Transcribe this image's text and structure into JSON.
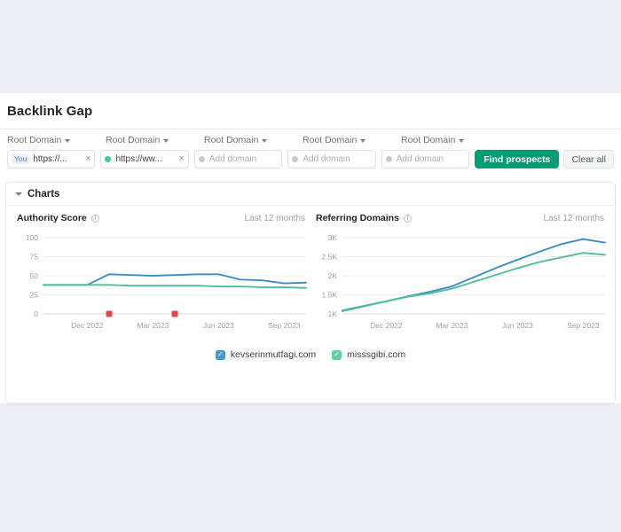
{
  "header": {
    "title": "Backlink Gap"
  },
  "toolbar": {
    "domain_label": "Root Domain",
    "columns": [
      {
        "label": "Root Domain",
        "badge": "You",
        "value": "https://...",
        "dot": null,
        "placeholder": null
      },
      {
        "label": "Root Domain",
        "badge": null,
        "value": "https://ww...",
        "dot": "green",
        "placeholder": null
      },
      {
        "label": "Root Domain",
        "badge": null,
        "value": null,
        "dot": "grey",
        "placeholder": "Add domain"
      },
      {
        "label": "Root Domain",
        "badge": null,
        "value": null,
        "dot": "grey",
        "placeholder": "Add domain"
      },
      {
        "label": "Root Domain",
        "badge": null,
        "value": null,
        "dot": "grey",
        "placeholder": "Add domain"
      }
    ],
    "find_prospects_label": "Find prospects",
    "clear_all_label": "Clear all",
    "close_icon": "×"
  },
  "charts_card": {
    "title": "Charts",
    "legend": [
      {
        "label": "kevserinmutfagi.com",
        "color": "#3f9ad6",
        "checked": true
      },
      {
        "label": "misssgibi.com",
        "color": "#5fd1a0",
        "checked": true
      }
    ],
    "check_glyph": "✓"
  },
  "colors": {
    "series_blue": "#3f8fc4",
    "series_green": "#4fbf96",
    "accent_green": "#009e74",
    "marker_red": "#e8434a",
    "page_bg": "#eceef4",
    "grid": "#eceef0"
  },
  "chart_data": [
    {
      "type": "line",
      "title": "Authority Score",
      "period": "Last 12 months",
      "xlabel": "",
      "ylabel": "",
      "ylim": [
        0,
        100
      ],
      "yticks": [
        "0",
        "25",
        "50",
        "75",
        "100"
      ],
      "ytick_values": [
        0,
        25,
        50,
        75,
        100
      ],
      "xticks": [
        "Dec 2022",
        "Mar 2023",
        "Jun 2023",
        "Sep 2023"
      ],
      "grid": true,
      "legend_position": "bottom",
      "x": [
        "Oct 2022",
        "Nov 2022",
        "Dec 2022",
        "Jan 2023",
        "Feb 2023",
        "Mar 2023",
        "Apr 2023",
        "May 2023",
        "Jun 2023",
        "Jul 2023",
        "Aug 2023",
        "Sep 2023",
        "Oct 2023"
      ],
      "series": [
        {
          "name": "kevserinmutfagi.com",
          "color": "#3f8fc4",
          "values": [
            38,
            38,
            38,
            52,
            51,
            50,
            51,
            52,
            52,
            45,
            44,
            40,
            41
          ]
        },
        {
          "name": "misssgibi.com",
          "color": "#4fbf96",
          "values": [
            38,
            38,
            38,
            38,
            37,
            37,
            37,
            37,
            36,
            36,
            35,
            35,
            34
          ]
        }
      ],
      "markers": [
        {
          "x": "Jan 2023",
          "y": 0,
          "color": "#e8434a"
        },
        {
          "x": "Apr 2023",
          "y": 0,
          "color": "#e8434a"
        }
      ]
    },
    {
      "type": "line",
      "title": "Referring Domains",
      "period": "Last 12 months",
      "xlabel": "",
      "ylabel": "",
      "ylim": [
        1000,
        3000
      ],
      "yticks": [
        "1K",
        "1.5K",
        "2K",
        "2.5K",
        "3K"
      ],
      "ytick_values": [
        1000,
        1500,
        2000,
        2500,
        3000
      ],
      "xticks": [
        "Dec 2022",
        "Mar 2023",
        "Jun 2023",
        "Sep 2023"
      ],
      "grid": true,
      "legend_position": "bottom",
      "x": [
        "Oct 2022",
        "Nov 2022",
        "Dec 2022",
        "Jan 2023",
        "Feb 2023",
        "Mar 2023",
        "Apr 2023",
        "May 2023",
        "Jun 2023",
        "Jul 2023",
        "Aug 2023",
        "Sep 2023",
        "Oct 2023"
      ],
      "series": [
        {
          "name": "kevserinmutfagi.com",
          "color": "#3f8fc4",
          "values": [
            1090,
            1210,
            1330,
            1460,
            1580,
            1720,
            1960,
            2200,
            2420,
            2630,
            2830,
            2960,
            2870
          ]
        },
        {
          "name": "misssgibi.com",
          "color": "#4fbf96",
          "values": [
            1070,
            1200,
            1330,
            1450,
            1540,
            1660,
            1840,
            2020,
            2200,
            2360,
            2480,
            2600,
            2550
          ]
        }
      ],
      "markers": []
    }
  ]
}
